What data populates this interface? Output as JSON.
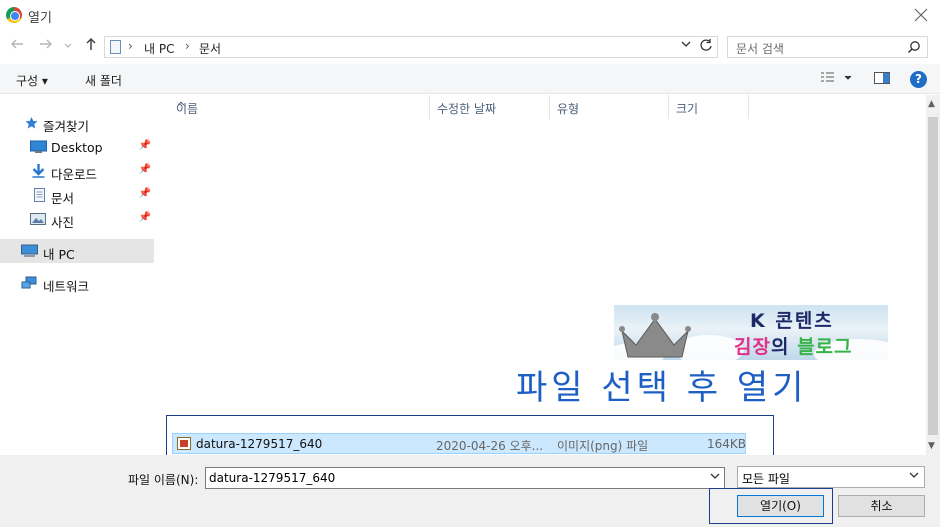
{
  "window": {
    "title": "열기",
    "colors": {
      "accent": "#0078d7",
      "selection": "#cce8ff",
      "annotation": "#1c3e8c",
      "caption": "#1d5fc4"
    }
  },
  "nav": {
    "back_icon": "arrow-left-icon",
    "forward_icon": "arrow-right-icon",
    "up_icon": "arrow-up-icon"
  },
  "address": {
    "crumbs": [
      "내 PC",
      "문서"
    ],
    "refresh_icon": "refresh-icon"
  },
  "search": {
    "placeholder": "문서 검색"
  },
  "toolbar": {
    "organize": "구성 ▾",
    "new_folder": "새 폴더",
    "help": "?"
  },
  "sidebar": {
    "items": [
      {
        "label": "즐겨찾기",
        "icon": "star-icon"
      },
      {
        "label": "Desktop",
        "icon": "desktop-icon",
        "pinned": true
      },
      {
        "label": "다운로드",
        "icon": "download-icon",
        "pinned": true
      },
      {
        "label": "문서",
        "icon": "document-icon",
        "pinned": true
      },
      {
        "label": "사진",
        "icon": "picture-icon",
        "pinned": true
      },
      {
        "label": "내 PC",
        "icon": "computer-icon",
        "selected": true
      },
      {
        "label": "네트워크",
        "icon": "network-icon"
      }
    ]
  },
  "columns": [
    "이름",
    "수정한 날짜",
    "유형",
    "크기"
  ],
  "files": [
    {
      "name": "datura-1279517_640",
      "modified": "2020-04-26 오후...",
      "type": "이미지(png) 파일",
      "size": "164KB",
      "selected": true
    }
  ],
  "overlay": {
    "banner_line1": "K 콘텐츠",
    "banner_line2a": "김장",
    "banner_line2b": "의 ",
    "banner_line2c": "블로그",
    "caption": "파일 선택 후 열기"
  },
  "bottom": {
    "filename_label": "파일 이름(N):",
    "filename_value": "datura-1279517_640",
    "filter_value": "모든 파일",
    "open_label": "열기(O)",
    "cancel_label": "취소"
  }
}
